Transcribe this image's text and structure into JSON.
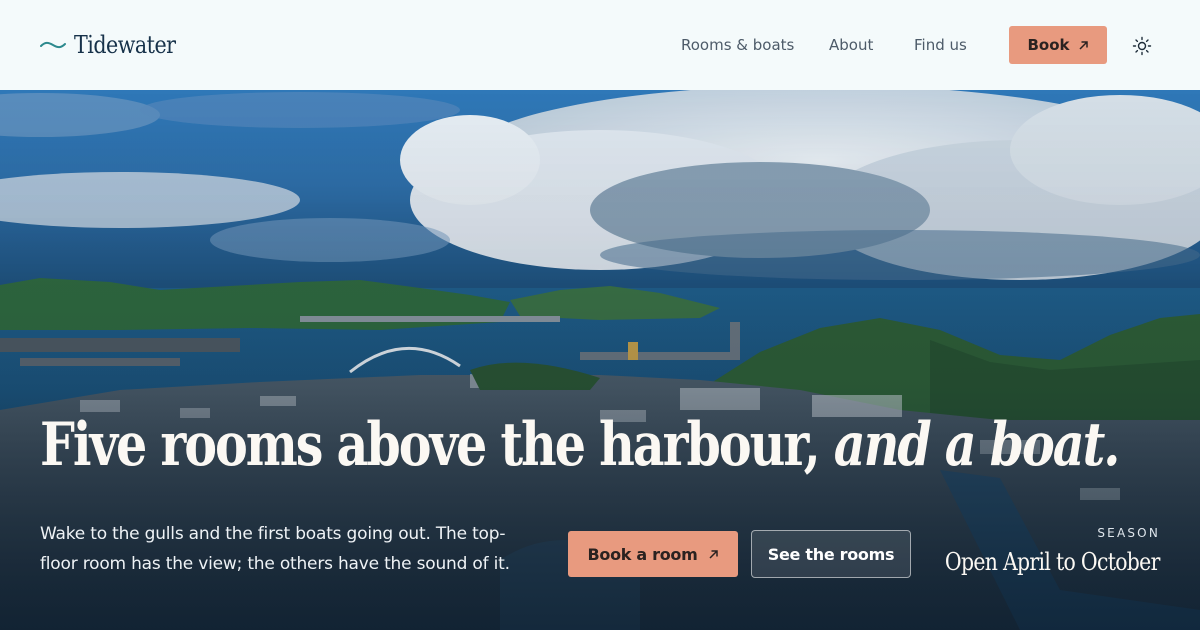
{
  "brand": {
    "name": "Tidewater",
    "icon": "wave-icon"
  },
  "nav": {
    "items": [
      {
        "label": "Rooms & boats"
      },
      {
        "label": "About"
      },
      {
        "label": "Find us"
      }
    ],
    "book_label": "Book",
    "book_icon": "arrow-up-right-icon",
    "theme_icon": "sun-icon"
  },
  "hero": {
    "headline_main": "Five rooms above the harbour,",
    "headline_italic": "and a boat.",
    "lede": "Wake to the gulls and the first boats going out. The top-floor room has the view; the others have the sound of it.",
    "primary_cta": "Book a room",
    "primary_cta_icon": "arrow-up-right-icon",
    "secondary_cta": "See the rooms",
    "season_label": "SEASON",
    "season_value": "Open April to October"
  },
  "colors": {
    "accent": "#e89a7f",
    "header_bg": "#f4fafb",
    "brand_text": "#17324a",
    "sea": "#1f5d86"
  }
}
